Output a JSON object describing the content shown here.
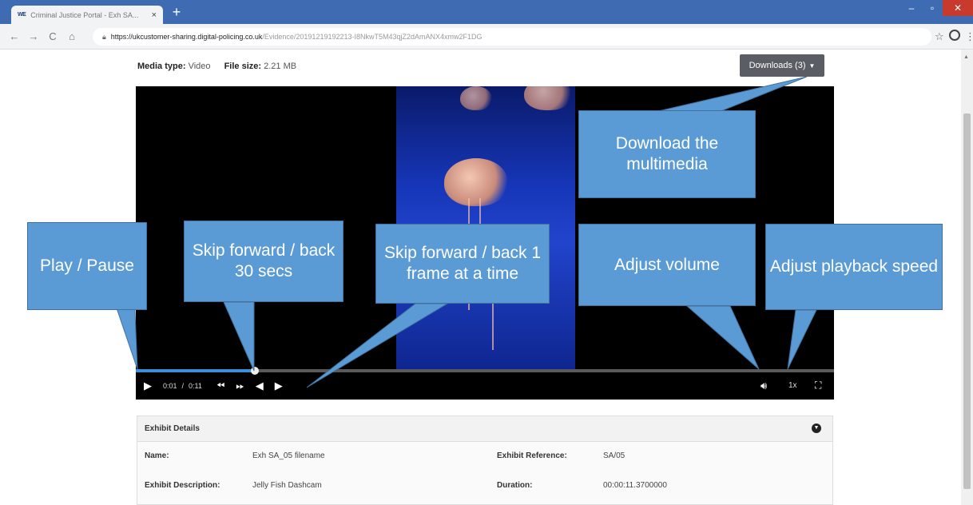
{
  "browser": {
    "tab_title": "Criminal Justice Portal - Exh SA...",
    "tab_favicon": "WE",
    "url_host": "https://ukcustomer-sharing.digital-policing.co.uk",
    "url_path": "/Evidence/20191219192213-I8NkwT5M43qjZ2dAmANX4xmw2F1DG"
  },
  "page": {
    "media_type_label": "Media type:",
    "media_type_value": "Video",
    "file_size_label": "File size:",
    "file_size_value": "2.21 MB",
    "downloads_label": "Downloads (3)"
  },
  "player": {
    "time_current": "0:01",
    "time_separator": "/",
    "time_total": "0:11",
    "speed": "1x",
    "progress_fraction": 0.17
  },
  "exhibit": {
    "header": "Exhibit Details",
    "name_label": "Name:",
    "name_value": "Exh SA_05 filename",
    "reference_label": "Exhibit Reference:",
    "reference_value": "SA/05",
    "description_label": "Exhibit Description:",
    "description_value": "Jelly Fish Dashcam",
    "duration_label": "Duration:",
    "duration_value": "00:00:11.3700000"
  },
  "callouts": {
    "download": "Download the multimedia",
    "play_pause": "Play / Pause",
    "skip_30": "Skip forward / back 30 secs",
    "skip_frame": "Skip forward / back 1 frame at a time",
    "volume": "Adjust volume",
    "playback_speed": "Adjust playback speed"
  },
  "colors": {
    "callout_fill": "#5b9bd5",
    "callout_border": "#41719c",
    "tabbar": "#3f6bb3",
    "progress": "#3a8fdd"
  }
}
